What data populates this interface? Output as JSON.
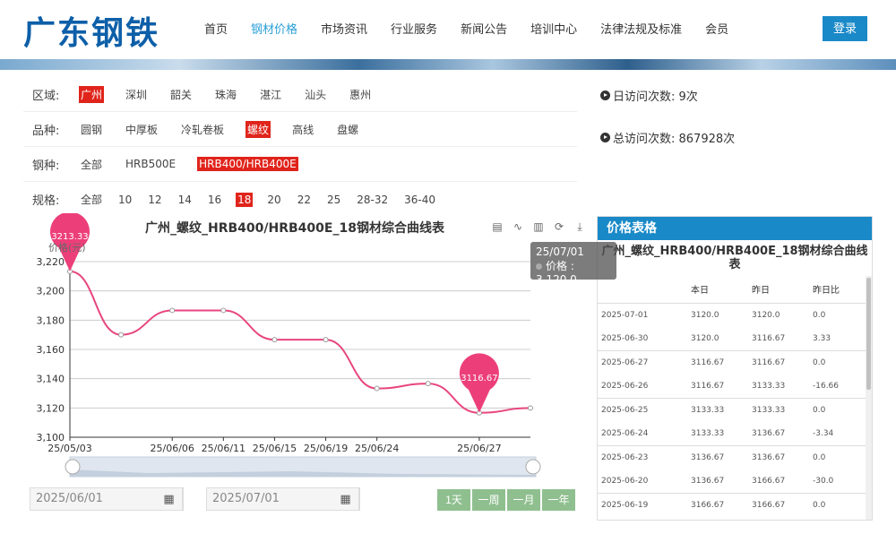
{
  "brand": {
    "logo": "广东钢铁",
    "color": "#0d5fa8"
  },
  "nav": [
    {
      "label": "首页",
      "active": false
    },
    {
      "label": "钢材价格",
      "active": true
    },
    {
      "label": "市场资讯",
      "active": false
    },
    {
      "label": "行业服务",
      "active": false
    },
    {
      "label": "新闻公告",
      "active": false
    },
    {
      "label": "培训中心",
      "active": false
    },
    {
      "label": "法律法规及标准",
      "active": false
    },
    {
      "label": "会员",
      "active": false
    }
  ],
  "login_label": "登录",
  "filters": {
    "region": {
      "label": "区域:",
      "options": [
        "广州",
        "深圳",
        "韶关",
        "珠海",
        "湛江",
        "汕头",
        "惠州"
      ],
      "selected": 0
    },
    "variety": {
      "label": "品种:",
      "options": [
        "圆钢",
        "中厚板",
        "冷轧卷板",
        "螺纹",
        "高线",
        "盘螺"
      ],
      "selected": 3
    },
    "grade": {
      "label": "钢种:",
      "options": [
        "全部",
        "HRB500E",
        "HRB400/HRB400E"
      ],
      "selected": 2
    },
    "spec": {
      "label": "规格:",
      "options": [
        "全部",
        "10",
        "12",
        "14",
        "16",
        "18",
        "20",
        "22",
        "25",
        "28-32",
        "36-40"
      ],
      "selected": 5
    }
  },
  "stats": {
    "daily": "日访问次数: 9次",
    "total": "总访问次数: 867928次"
  },
  "chart": {
    "title": "广州_螺纹_HRB400/HRB400E_18钢材综合曲线表",
    "partial_label": "价格(元)",
    "toolbox": [
      "data-view-icon",
      "line-icon",
      "bar-icon",
      "restore-icon",
      "download-icon"
    ],
    "tooltip": {
      "date": "25/07/01",
      "label": "价格 : 3,120.0"
    },
    "max_pin": "3213.33",
    "min_pin": "3116.67",
    "line_color": "#e8457f",
    "pin_color": "#ec3f7a"
  },
  "chart_data": {
    "type": "line",
    "x": [
      "25/05/03",
      "25/05/30",
      "25/06/06",
      "25/06/11",
      "25/06/15",
      "25/06/19",
      "25/06/24",
      "25/06/26",
      "25/06/27",
      "25/07/01"
    ],
    "series": [
      {
        "values": [
          3213.33,
          3170,
          3186.67,
          3186.67,
          3166.67,
          3166.67,
          3133.33,
          3136.67,
          3116.67,
          3120
        ]
      }
    ],
    "xticks": [
      "25/05/03",
      "25/06/06",
      "25/06/11",
      "25/06/15",
      "25/06/19",
      "25/06/24",
      "25/06/27"
    ],
    "yticks": [
      "3,100",
      "3,120",
      "3,140",
      "3,160",
      "3,180",
      "3,200",
      "3,220"
    ],
    "ylim": [
      3100,
      3220
    ]
  },
  "dates": {
    "start": "2025/06/01",
    "end": "2025/07/01"
  },
  "range_buttons": [
    "1天",
    "一周",
    "一月",
    "一年"
  ],
  "price_table": {
    "header": "价格表格",
    "subtitle": "广州_螺纹_HRB400/HRB400E_18钢材综合曲线表",
    "columns": [
      "",
      "本日",
      "昨日",
      "昨日比"
    ],
    "rows": [
      {
        "date": "2025-07-01",
        "today": "3120.0",
        "yesterday": "3120.0",
        "change": "0.0",
        "dir": "flat"
      },
      {
        "date": "2025-06-30",
        "today": "3120.0",
        "yesterday": "3116.67",
        "change": "3.33",
        "dir": "up"
      },
      {
        "date": "2025-06-27",
        "today": "3116.67",
        "yesterday": "3116.67",
        "change": "0.0",
        "dir": "flat"
      },
      {
        "date": "2025-06-26",
        "today": "3116.67",
        "yesterday": "3133.33",
        "change": "-16.66",
        "dir": "down"
      },
      {
        "date": "2025-06-25",
        "today": "3133.33",
        "yesterday": "3133.33",
        "change": "0.0",
        "dir": "flat"
      },
      {
        "date": "2025-06-24",
        "today": "3133.33",
        "yesterday": "3136.67",
        "change": "-3.34",
        "dir": "down"
      },
      {
        "date": "2025-06-23",
        "today": "3136.67",
        "yesterday": "3136.67",
        "change": "0.0",
        "dir": "flat"
      },
      {
        "date": "2025-06-20",
        "today": "3136.67",
        "yesterday": "3166.67",
        "change": "-30.0",
        "dir": "down"
      },
      {
        "date": "2025-06-19",
        "today": "3166.67",
        "yesterday": "3166.67",
        "change": "0.0",
        "dir": "flat"
      }
    ]
  }
}
